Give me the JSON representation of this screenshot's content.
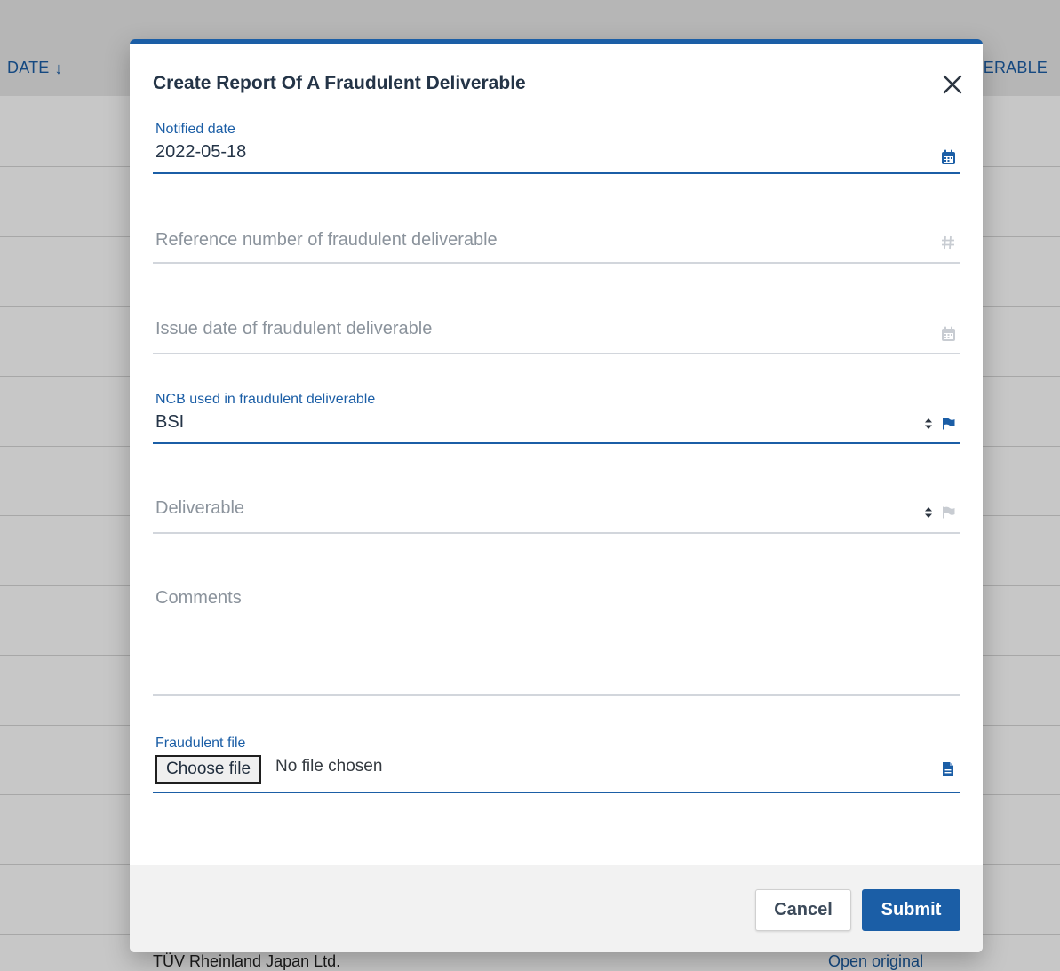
{
  "background_table": {
    "left_column_header": "DATE",
    "right_column_header": "ERABLE",
    "bottom_row_left": "TÜV Rheinland Japan Ltd.",
    "bottom_row_right": "Open original"
  },
  "modal": {
    "title": "Create Report Of A Fraudulent Deliverable",
    "fields": {
      "notified_date": {
        "label": "Notified date",
        "value": "2022-05-18",
        "icon": "calendar-icon"
      },
      "reference_number": {
        "placeholder": "Reference number of fraudulent deliverable",
        "icon": "hash-icon"
      },
      "issue_date": {
        "placeholder": "Issue date of fraudulent deliverable",
        "icon": "calendar-icon"
      },
      "ncb": {
        "label": "NCB used in fraudulent deliverable",
        "value": "BSI",
        "icons": [
          "sort-icon",
          "flag-icon"
        ]
      },
      "deliverable": {
        "placeholder": "Deliverable",
        "icons": [
          "sort-icon",
          "flag-icon"
        ]
      },
      "comments": {
        "placeholder": "Comments"
      },
      "fraudulent_file": {
        "label": "Fraudulent file",
        "button_label": "Choose file",
        "status": "No file chosen",
        "icon": "file-icon"
      }
    },
    "footer": {
      "cancel_label": "Cancel",
      "submit_label": "Submit"
    }
  },
  "colors": {
    "accent": "#1b5ea6",
    "muted_icon": "#c8ccd2",
    "text": "#243447"
  }
}
